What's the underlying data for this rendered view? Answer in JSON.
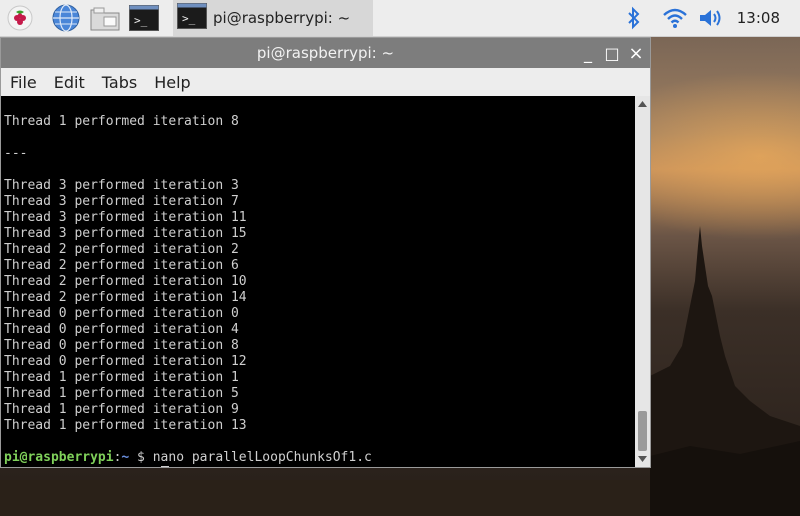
{
  "taskbar": {
    "launchers": [
      {
        "icon": "raspberry-menu-icon"
      },
      {
        "icon": "globe-browser-icon"
      },
      {
        "icon": "folder-icon"
      },
      {
        "icon": "terminal-icon"
      }
    ],
    "active_task": {
      "label": "pi@raspberrypi: ~",
      "icon": "terminal-icon"
    },
    "tray": {
      "bluetooth_icon": "bluetooth-icon",
      "wifi_icon": "wifi-icon",
      "volume_icon": "volume-icon"
    },
    "clock": "13:08"
  },
  "window": {
    "title": "pi@raspberrypi: ~",
    "controls": {
      "minimize": "_",
      "maximize": "□",
      "close": "×"
    },
    "menu": [
      "File",
      "Edit",
      "Tabs",
      "Help"
    ]
  },
  "terminal": {
    "lines": [
      "Thread 1 performed iteration 8",
      "",
      "---",
      "",
      "Thread 3 performed iteration 3",
      "Thread 3 performed iteration 7",
      "Thread 3 performed iteration 11",
      "Thread 3 performed iteration 15",
      "Thread 2 performed iteration 2",
      "Thread 2 performed iteration 6",
      "Thread 2 performed iteration 10",
      "Thread 2 performed iteration 14",
      "Thread 0 performed iteration 0",
      "Thread 0 performed iteration 4",
      "Thread 0 performed iteration 8",
      "Thread 0 performed iteration 12",
      "Thread 1 performed iteration 1",
      "Thread 1 performed iteration 5",
      "Thread 1 performed iteration 9",
      "Thread 1 performed iteration 13",
      ""
    ],
    "prompt_user": "pi@raspberrypi",
    "prompt_sep": ":",
    "prompt_path": "~",
    "prompt_symbol": " $ ",
    "last_command": "nano parallelLoopChunksOf1.c",
    "current_input": ""
  },
  "colors": {
    "prompt_user": "#7fd05a",
    "prompt_path": "#6a8fe0",
    "terminal_bg": "#000000",
    "titlebar": "#7d7d7d"
  }
}
